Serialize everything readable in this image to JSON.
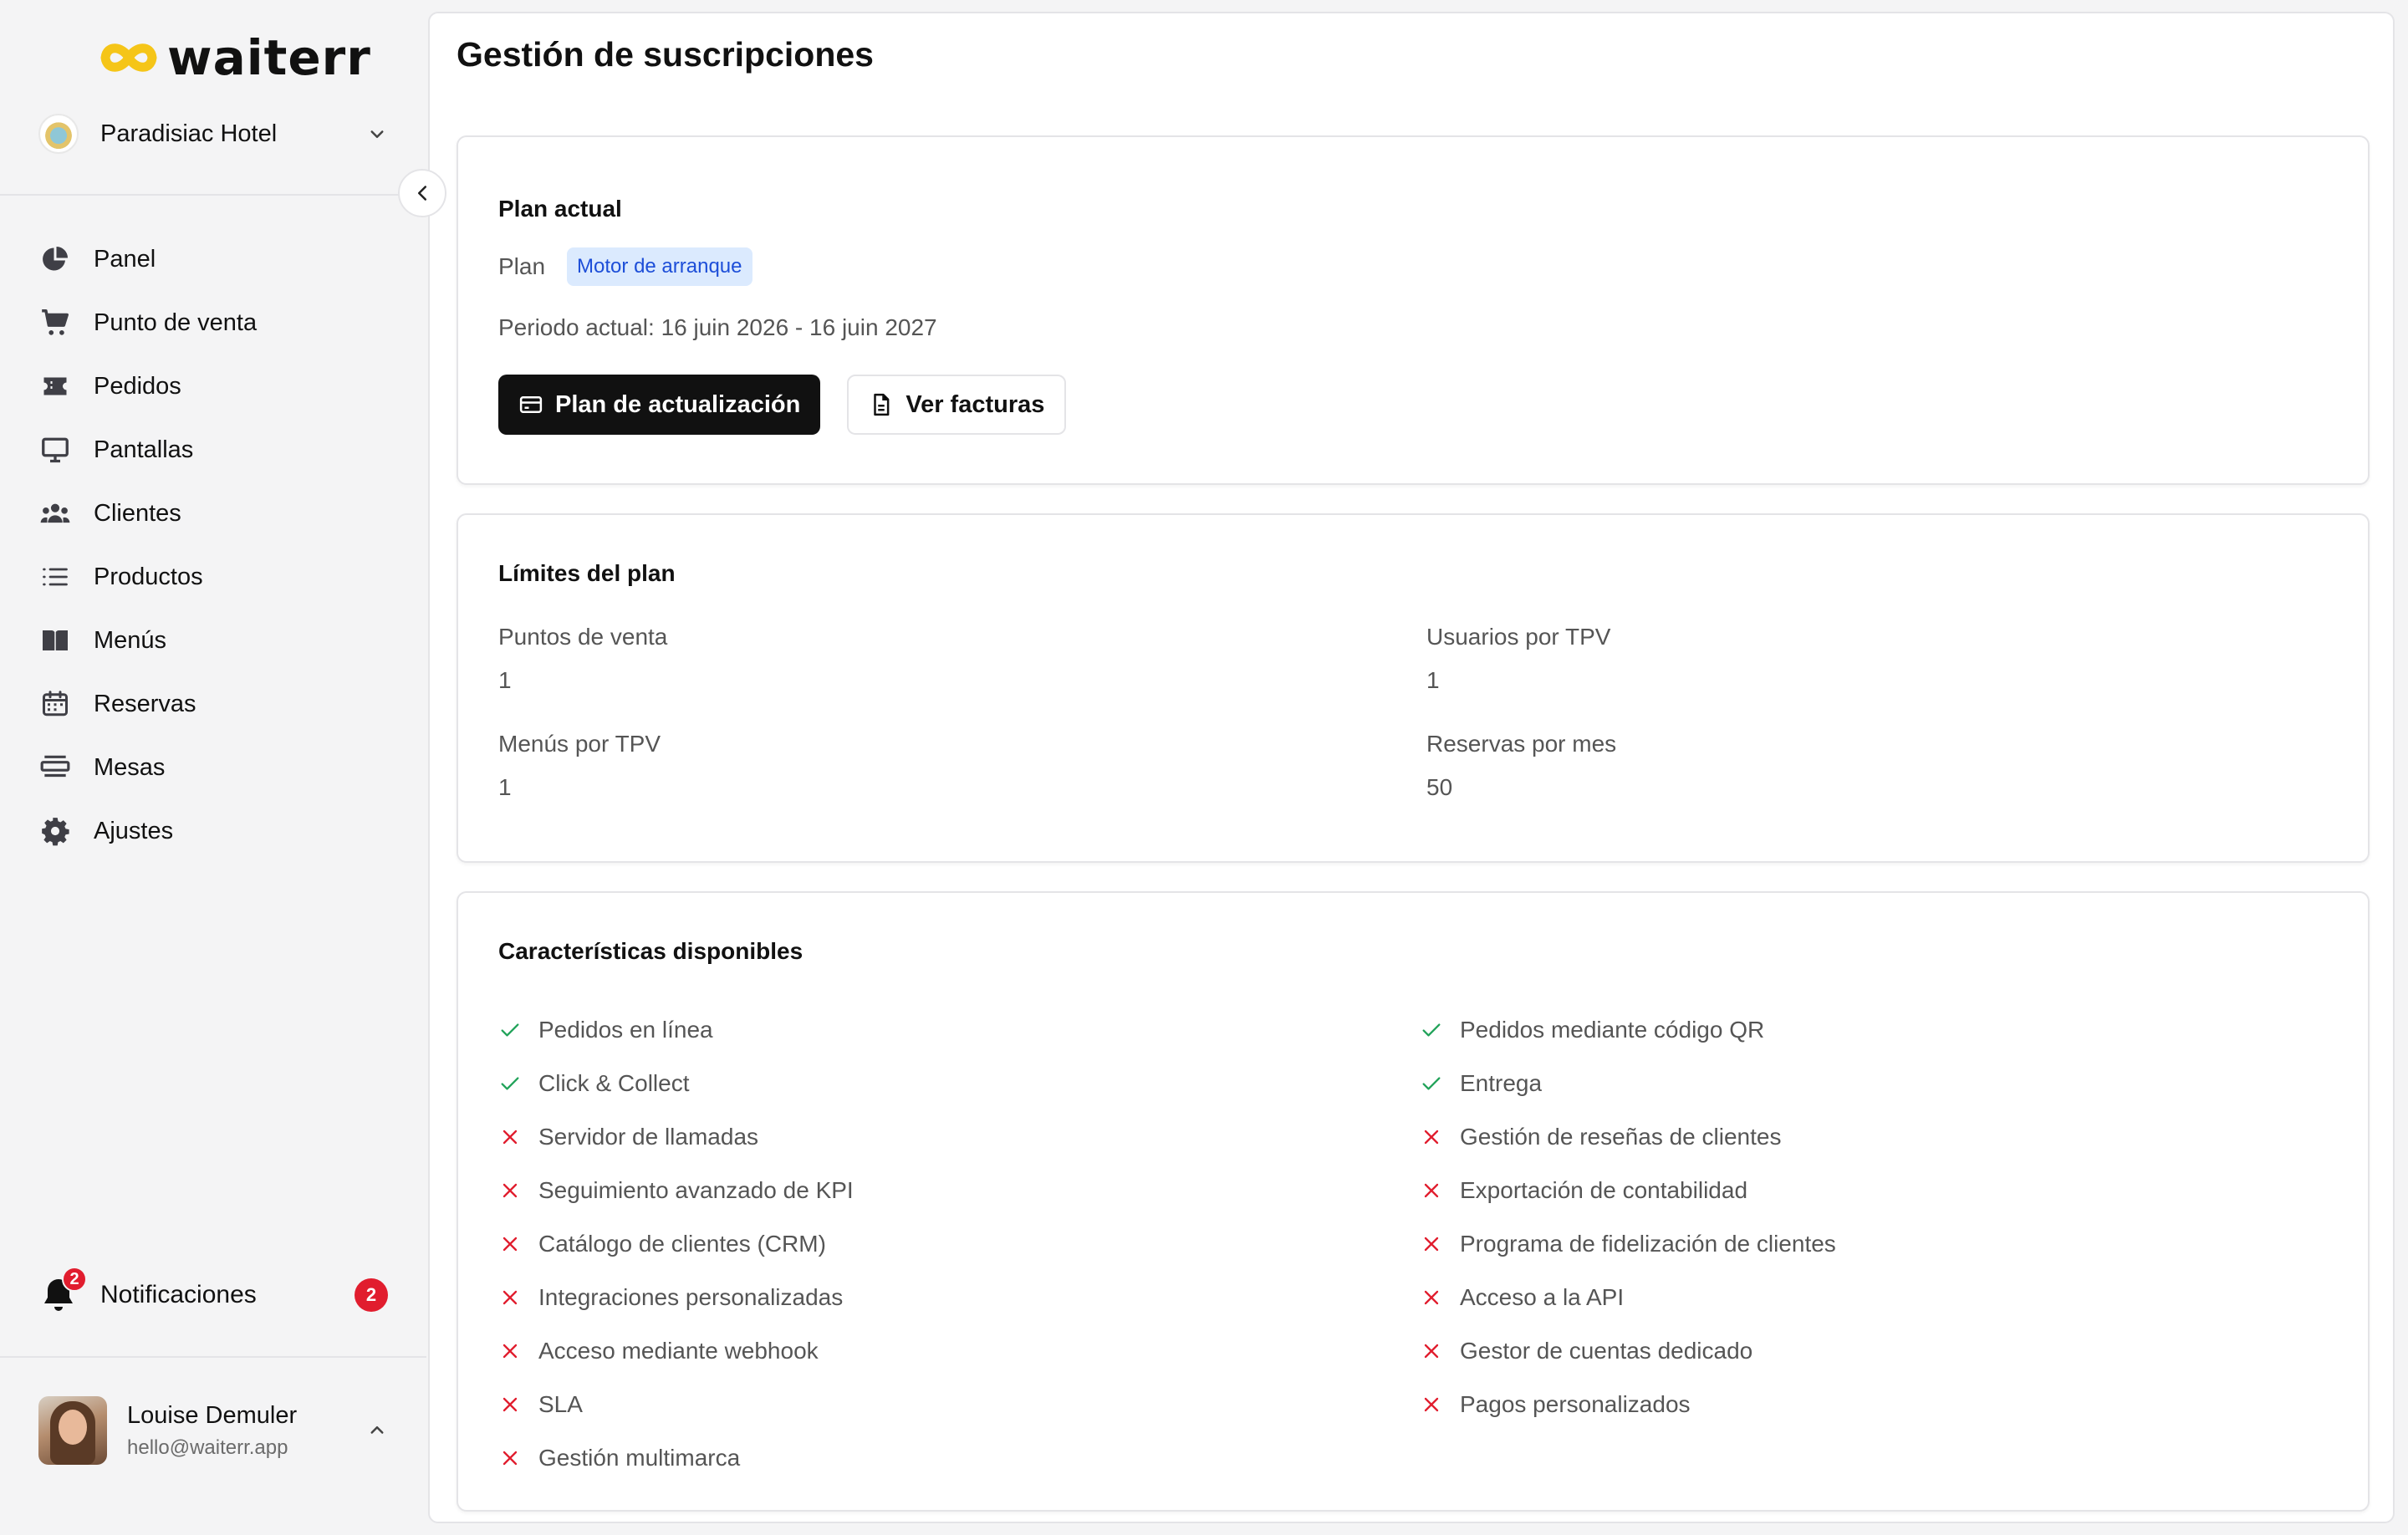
{
  "app": {
    "logo_text": "waiterr"
  },
  "workspace": {
    "name": "Paradisiac Hotel"
  },
  "nav": {
    "items": [
      {
        "label": "Panel",
        "icon": "pie-chart-icon"
      },
      {
        "label": "Punto de venta",
        "icon": "cart-icon"
      },
      {
        "label": "Pedidos",
        "icon": "ticket-icon"
      },
      {
        "label": "Pantallas",
        "icon": "monitor-icon"
      },
      {
        "label": "Clientes",
        "icon": "users-icon"
      },
      {
        "label": "Productos",
        "icon": "list-icon"
      },
      {
        "label": "Menús",
        "icon": "book-icon"
      },
      {
        "label": "Reservas",
        "icon": "calendar-icon"
      },
      {
        "label": "Mesas",
        "icon": "table-icon"
      },
      {
        "label": "Ajustes",
        "icon": "gear-icon"
      }
    ]
  },
  "notifications": {
    "label": "Notificaciones",
    "count": "2",
    "bell_badge": "2"
  },
  "user": {
    "name": "Louise Demuler",
    "email": "hello@waiterr.app"
  },
  "page": {
    "title": "Gestión de suscripciones"
  },
  "plan": {
    "title": "Plan actual",
    "plan_label": "Plan",
    "plan_name": "Motor de arranque",
    "period": "Periodo actual: 16 juin 2026 - 16 juin 2027",
    "upgrade_label": "Plan de actualización",
    "invoices_label": "Ver facturas"
  },
  "limits": {
    "title": "Límites del plan",
    "items": [
      {
        "label": "Puntos de venta",
        "value": "1"
      },
      {
        "label": "Usuarios por TPV",
        "value": "1"
      },
      {
        "label": "Menús por TPV",
        "value": "1"
      },
      {
        "label": "Reservas por mes",
        "value": "50"
      }
    ]
  },
  "features": {
    "title": "Características disponibles",
    "left": [
      {
        "label": "Pedidos en línea",
        "available": true
      },
      {
        "label": "Click & Collect",
        "available": true
      },
      {
        "label": "Servidor de llamadas",
        "available": false
      },
      {
        "label": "Seguimiento avanzado de KPI",
        "available": false
      },
      {
        "label": "Catálogo de clientes (CRM)",
        "available": false
      },
      {
        "label": "Integraciones personalizadas",
        "available": false
      },
      {
        "label": "Acceso mediante webhook",
        "available": false
      },
      {
        "label": "SLA",
        "available": false
      },
      {
        "label": "Gestión multimarca",
        "available": false
      }
    ],
    "right": [
      {
        "label": "Pedidos mediante código QR",
        "available": true
      },
      {
        "label": "Entrega",
        "available": true
      },
      {
        "label": "Gestión de reseñas de clientes",
        "available": false
      },
      {
        "label": "Exportación de contabilidad",
        "available": false
      },
      {
        "label": "Programa de fidelización de clientes",
        "available": false
      },
      {
        "label": "Acceso a la API",
        "available": false
      },
      {
        "label": "Gestor de cuentas dedicado",
        "available": false
      },
      {
        "label": "Pagos personalizados",
        "available": false
      }
    ]
  },
  "colors": {
    "check": "#22a35a",
    "cross": "#e11d2e",
    "badge_bg": "#dbeafe",
    "badge_text": "#1d4ed8",
    "logo_yellow": "#f5c518"
  }
}
